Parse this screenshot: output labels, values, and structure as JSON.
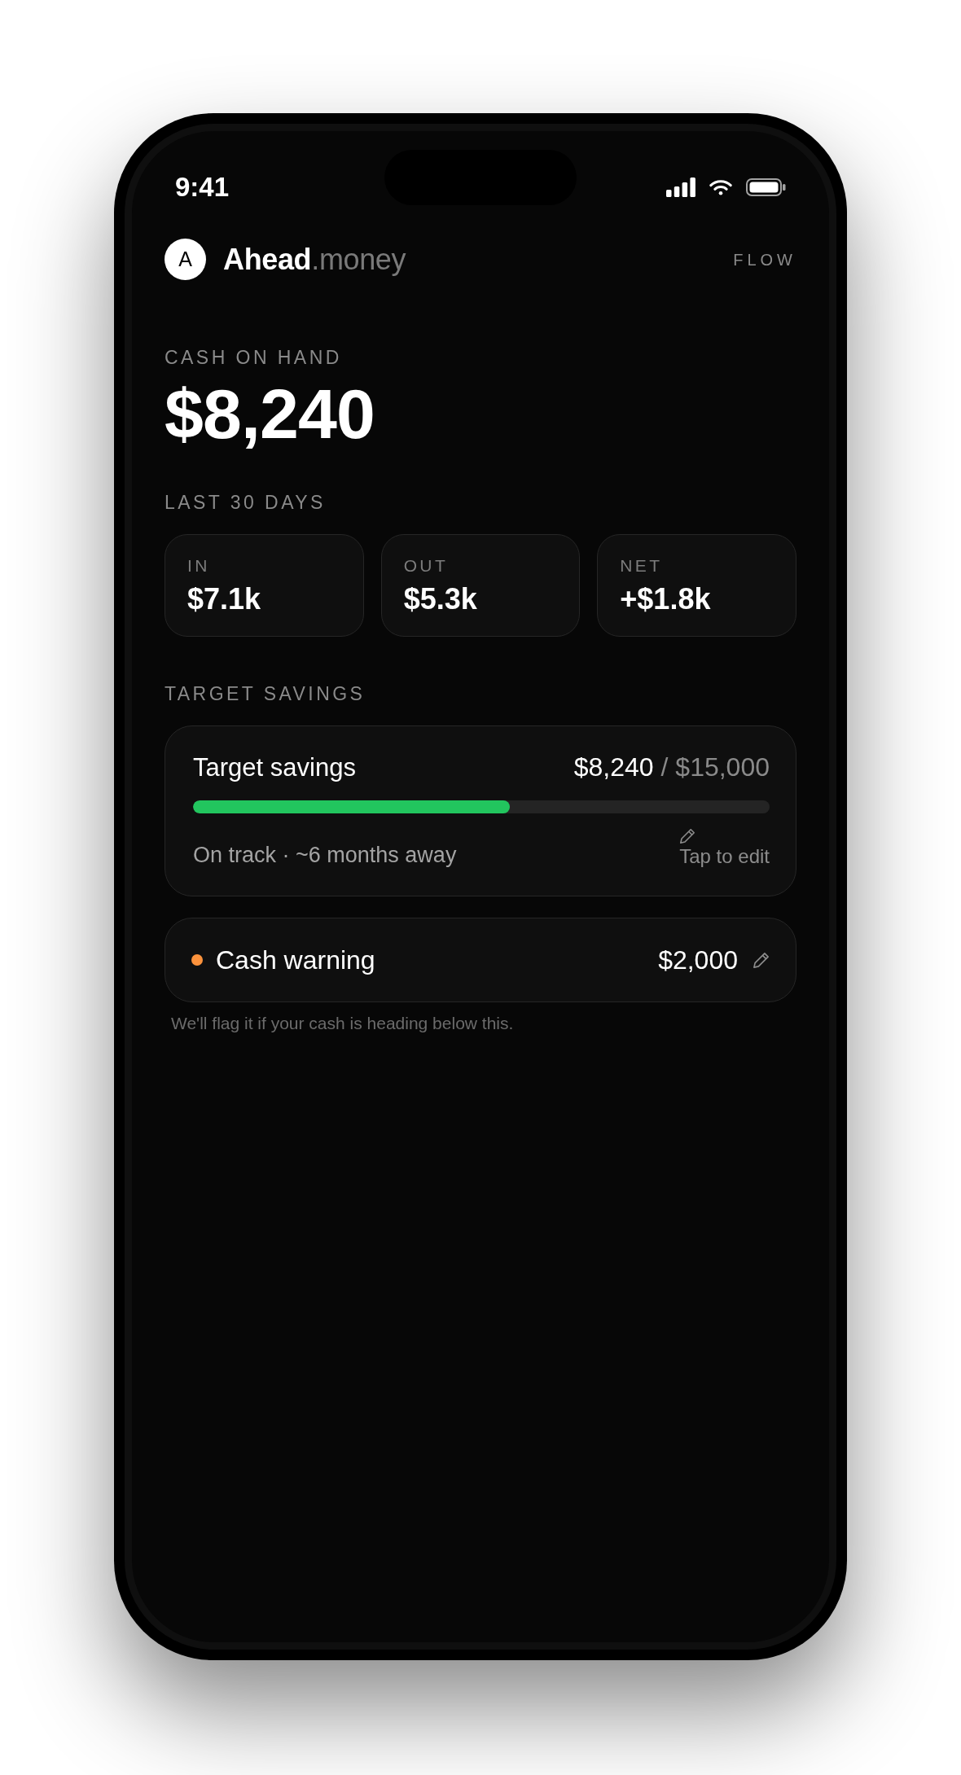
{
  "status_bar": {
    "time": "9:41"
  },
  "header": {
    "logo_mark": "A",
    "brand": "**Ahead**.money",
    "nav_label": "FLOW"
  },
  "cash_on_hand": {
    "label": "CASH ON HAND",
    "amount": "$8,240"
  },
  "last_30_days": {
    "label": "LAST 30 DAYS",
    "stats": [
      {
        "label": "IN",
        "value": "$7.1k"
      },
      {
        "label": "OUT",
        "value": "$5.3k"
      },
      {
        "label": "NET",
        "value": "+$1.8k"
      }
    ]
  },
  "target_savings": {
    "section_label": "TARGET SAVINGS",
    "title": "Target savings",
    "saved": "$8,240",
    "goal": "/ $15,000",
    "level": 0.55,
    "status": "On track · ~6 months away",
    "edit_label": "Tap to edit"
  },
  "cash_warning": {
    "label": "Cash warning",
    "amount": "$2,000",
    "hint": "We'll flag it if your cash is heading below this."
  }
}
